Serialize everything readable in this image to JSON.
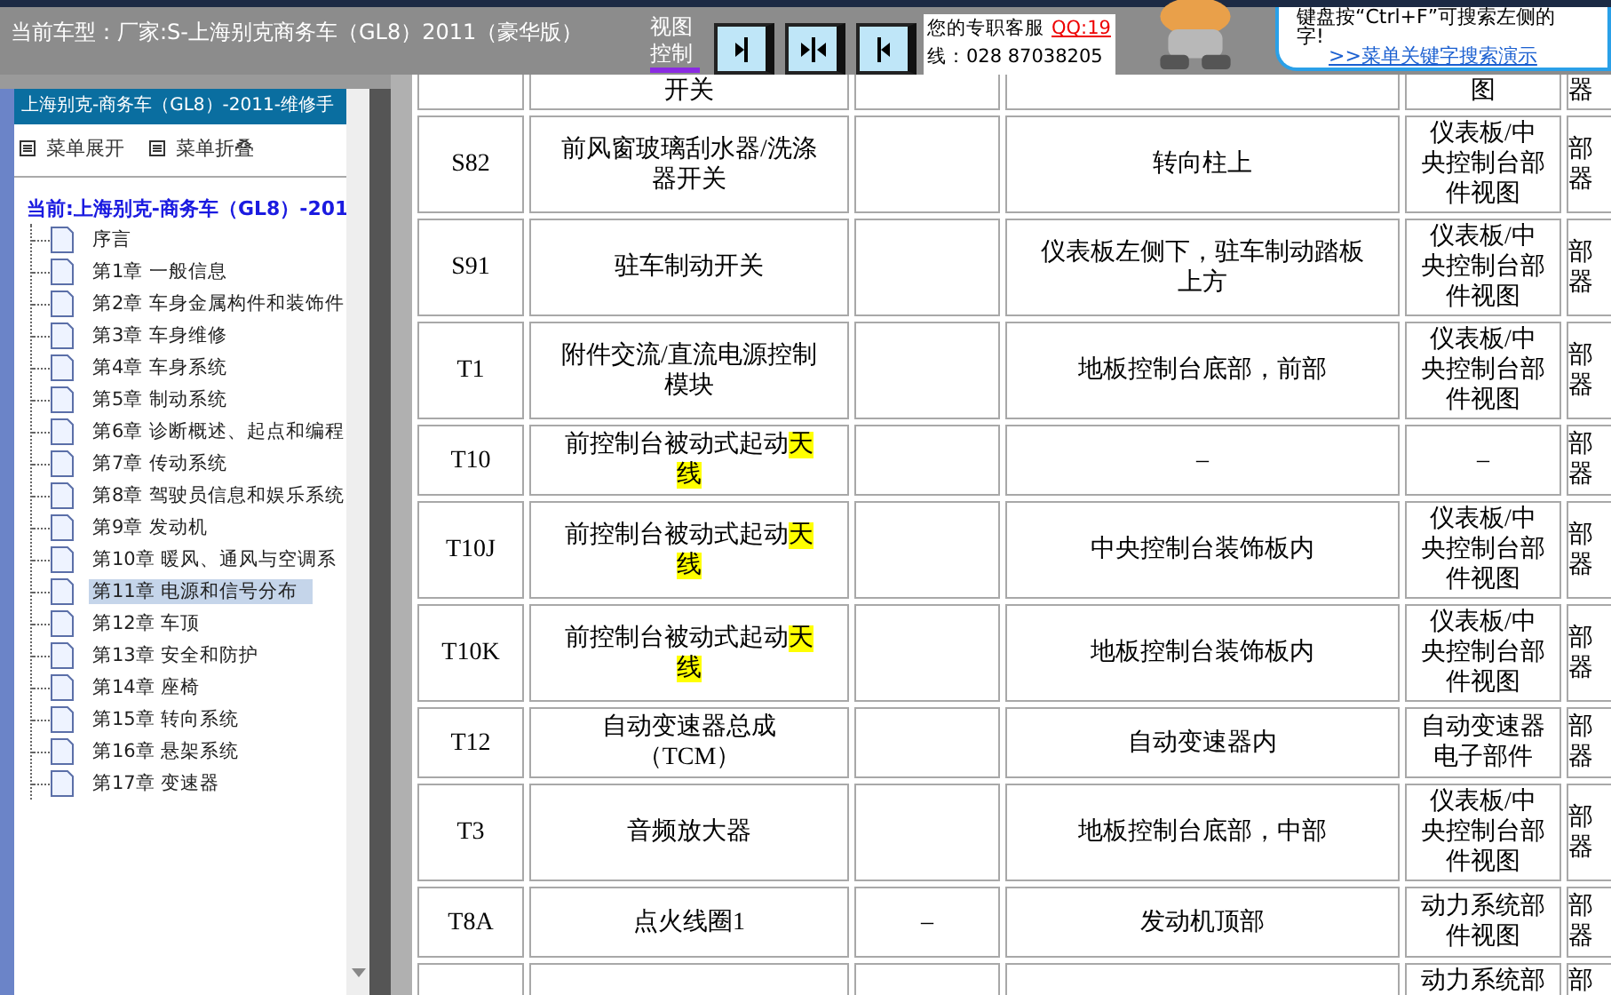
{
  "header": {
    "vehicle": "当前车型：厂家:S-上海别克商务车（GL8）2011（豪华版）",
    "view_control": "视图控制",
    "view_buttons": [
      {
        "kind": "right"
      },
      {
        "kind": "center"
      },
      {
        "kind": "left"
      }
    ],
    "service": {
      "label": "您的专职客服",
      "qq": "QQ:19",
      "phone": "线：028 87038205"
    },
    "hint": {
      "text": "键盘按“Ctrl+F”可搜索左侧的",
      "text_2": "字!",
      "link": ">>菜单关键字搜索演示"
    }
  },
  "sidebar": {
    "title": "上海别克-商务车（GL8）-2011-维修手",
    "actions": [
      "菜单展开",
      "菜单折叠"
    ],
    "root": "当前:上海别克-商务车（GL8）-201",
    "items": [
      {
        "label": "序言",
        "selected": false
      },
      {
        "label": "第1章 一般信息",
        "selected": false
      },
      {
        "label": "第2章 车身金属构件和装饰件",
        "selected": false
      },
      {
        "label": "第3章 车身维修",
        "selected": false
      },
      {
        "label": "第4章 车身系统",
        "selected": false
      },
      {
        "label": "第5章 制动系统",
        "selected": false
      },
      {
        "label": "第6章 诊断概述、起点和编程",
        "selected": false
      },
      {
        "label": "第7章 传动系统",
        "selected": false
      },
      {
        "label": "第8章 驾驶员信息和娱乐系统",
        "selected": false
      },
      {
        "label": "第9章 发动机",
        "selected": false
      },
      {
        "label": "第10章 暖风、通风与空调系",
        "selected": false
      },
      {
        "label": "第11章 电源和信号分布",
        "selected": true
      },
      {
        "label": "第12章 车顶",
        "selected": false
      },
      {
        "label": "第13章 安全和防护",
        "selected": false
      },
      {
        "label": "第14章 座椅",
        "selected": false
      },
      {
        "label": "第15章 转向系统",
        "selected": false
      },
      {
        "label": "第16章 悬架系统",
        "selected": false
      },
      {
        "label": "第17章 变速器",
        "selected": false
      }
    ]
  },
  "table": {
    "rows": [
      {
        "kind": "partial",
        "code": "",
        "name": "开关",
        "column_3": "",
        "location": "",
        "view": "图",
        "column_6": "器"
      },
      {
        "code": "S82",
        "name": "前风窗玻璃刮水器/洗涤器开关",
        "column_3": "",
        "location": "转向柱上",
        "view": "仪表板/中央控制台部件视图",
        "column_6": "部器"
      },
      {
        "code": "S91",
        "name": "驻车制动开关",
        "column_3": "",
        "location": "仪表板左侧下，驻车制动踏板上方",
        "view": "仪表板/中央控制台部件视图",
        "column_6": "部器"
      },
      {
        "code": "T1",
        "name": "附件交流/直流电源控制模块",
        "column_3": "",
        "location": "地板控制台底部，前部",
        "view": "仪表板/中央控制台部件视图",
        "column_6": "部器"
      },
      {
        "code": "T10",
        "name": "前控制台被动式起动",
        "highlight": "天线",
        "column_3": "",
        "location": "–",
        "view": "–",
        "column_6": "部器"
      },
      {
        "code": "T10J",
        "name": "前控制台被动式起动",
        "highlight": "天线",
        "column_3": "",
        "location": "中央控制台装饰板内",
        "view": "仪表板/中央控制台部件视图",
        "column_6": "部器"
      },
      {
        "code": "T10K",
        "name": "前控制台被动式起动",
        "highlight": "天线",
        "column_3": "",
        "location": "地板控制台装饰板内",
        "view": "仪表板/中央控制台部件视图",
        "column_6": "部器"
      },
      {
        "code": "T12",
        "name": "自动变速器总成（TCM）",
        "column_3": "",
        "location": "自动变速器内",
        "view": "自动变速器电子部件",
        "column_6": "部器"
      },
      {
        "code": "T3",
        "name": "音频放大器",
        "column_3": "",
        "location": "地板控制台底部，中部",
        "view": "仪表板/中央控制台部件视图",
        "column_6": "部器"
      },
      {
        "code": "T8A",
        "name": "点火线圈1",
        "column_3": "–",
        "location": "发动机顶部",
        "view": "动力系统部件视图",
        "column_6": "部器"
      },
      {
        "kind": "partial",
        "code": "",
        "name": "",
        "column_3": "",
        "location": "",
        "view": "动力系统部",
        "column_6": "部"
      }
    ]
  }
}
